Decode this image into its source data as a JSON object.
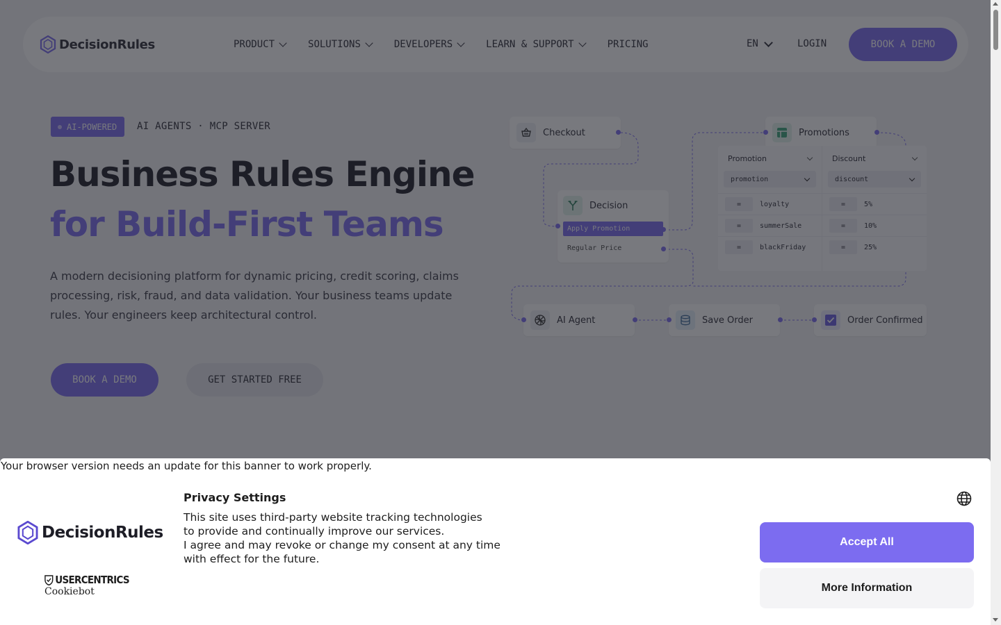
{
  "nav": {
    "logo_text": "DecisionRules",
    "items": [
      {
        "label": "PRODUCT",
        "has_dropdown": true
      },
      {
        "label": "SOLUTIONS",
        "has_dropdown": true
      },
      {
        "label": "DEVELOPERS",
        "has_dropdown": true
      },
      {
        "label": "LEARN & SUPPORT",
        "has_dropdown": true
      },
      {
        "label": "PRICING",
        "has_dropdown": false
      }
    ],
    "language": "EN",
    "login": "LOGIN",
    "book_demo": "BOOK A DEMO"
  },
  "hero": {
    "badge": "AI-POWERED",
    "badge_side": "AI AGENTS · MCP SERVER",
    "title_line1": "Business Rules Engine",
    "title_line2": "for Build-First Teams",
    "lead": "A modern decisioning platform for dynamic pricing, credit scoring, claims processing, risk, fraud, and data validation. Your business teams update rules. Your engineers keep architectural control.",
    "cta_primary": "BOOK A DEMO",
    "cta_secondary": "GET STARTED FREE"
  },
  "diagram": {
    "checkout": "Checkout",
    "promotions": "Promotions",
    "decision": "Decision",
    "apply_promotion": "Apply Promotion",
    "regular_price": "Regular Price",
    "ai_agent": "AI Agent",
    "save_order": "Save Order",
    "order_confirmed": "Order Confirmed",
    "table": {
      "col1_header": "Promotion",
      "col1_select": "promotion",
      "col2_header": "Discount",
      "col2_select": "discount",
      "operator": "=",
      "rows": [
        {
          "promotion": "loyalty",
          "discount": "5%"
        },
        {
          "promotion": "summerSale",
          "discount": "10%"
        },
        {
          "promotion": "blackFriday",
          "discount": "25%"
        }
      ]
    }
  },
  "cookie_banner": {
    "browser_warning": "Your browser version needs an update for this banner to work properly.",
    "logo_text": "DecisionRules",
    "provider_top": "USERCENTRICS",
    "provider_bottom": "Cookiebot",
    "title": "Privacy Settings",
    "text_line1": "This site uses third-party website tracking technologies",
    "text_line2": "to provide and continually improve our services.",
    "text_line3": "I agree and may revoke or change my consent at any time",
    "text_line4": "with effect for the future.",
    "accept_all": "Accept All",
    "more_info": "More Information"
  },
  "colors": {
    "accent": "#7c6cf0",
    "overlay": "#1e1f28"
  }
}
